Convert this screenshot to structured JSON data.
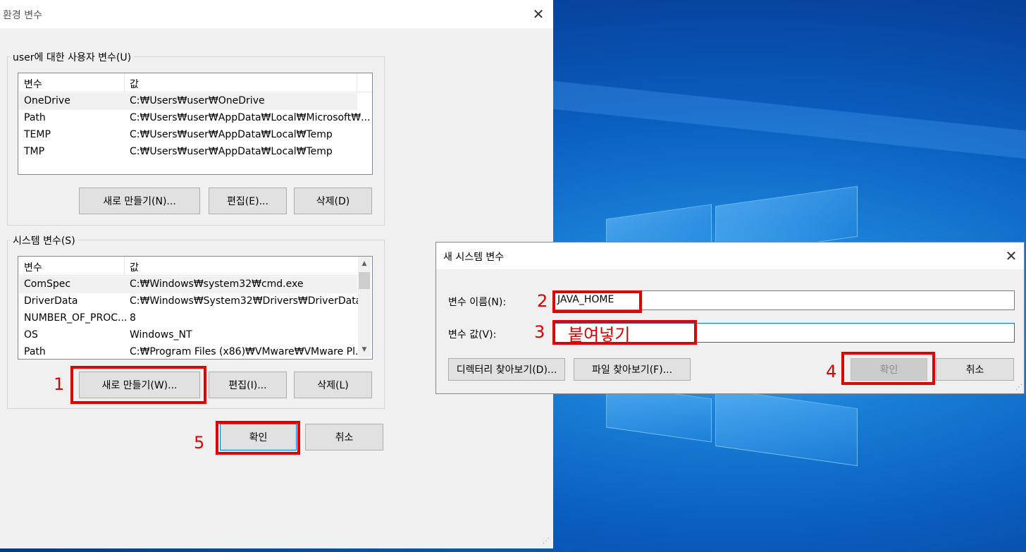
{
  "desktop": {
    "accent": "#0a5fc0"
  },
  "env_dialog": {
    "title": "환경 변수",
    "user_group": {
      "label": "user에 대한 사용자 변수(U)",
      "columns": [
        "변수",
        "값"
      ],
      "rows": [
        {
          "name": "OneDrive",
          "value": "C:₩Users₩user₩OneDrive",
          "selected": true
        },
        {
          "name": "Path",
          "value": "C:₩Users₩user₩AppData₩Local₩Microsoft₩...",
          "selected": false
        },
        {
          "name": "TEMP",
          "value": "C:₩Users₩user₩AppData₩Local₩Temp",
          "selected": false
        },
        {
          "name": "TMP",
          "value": "C:₩Users₩user₩AppData₩Local₩Temp",
          "selected": false
        }
      ],
      "buttons": {
        "new": "새로 만들기(N)...",
        "edit": "편집(E)...",
        "delete": "삭제(D)"
      }
    },
    "system_group": {
      "label": "시스템 변수(S)",
      "columns": [
        "변수",
        "값"
      ],
      "rows": [
        {
          "name": "ComSpec",
          "value": "C:₩Windows₩system32₩cmd.exe",
          "selected": true
        },
        {
          "name": "DriverData",
          "value": "C:₩Windows₩System32₩Drivers₩DriverData",
          "selected": false
        },
        {
          "name": "NUMBER_OF_PROC...",
          "value": "8",
          "selected": false
        },
        {
          "name": "OS",
          "value": "Windows_NT",
          "selected": false
        },
        {
          "name": "Path",
          "value": "C:₩Program Files (x86)₩VMware₩VMware Pl...",
          "selected": false
        }
      ],
      "buttons": {
        "new": "새로 만들기(W)...",
        "edit": "편집(I)...",
        "delete": "삭제(L)"
      }
    },
    "ok": "확인",
    "cancel": "취소"
  },
  "new_var_dialog": {
    "title": "새 시스템 변수",
    "name_label": "변수 이름(N):",
    "name_value": "JAVA_HOME",
    "value_label": "변수 값(V):",
    "value_value": "",
    "browse_dir": "디렉터리 찾아보기(D)...",
    "browse_file": "파일 찾아보기(F)...",
    "ok": "확인",
    "cancel": "취소"
  },
  "annotations": {
    "color": "#e00000",
    "step1": "1",
    "step2": "2",
    "step3": "3",
    "step3_text": "붙여넣기",
    "step4": "4",
    "step5": "5"
  }
}
